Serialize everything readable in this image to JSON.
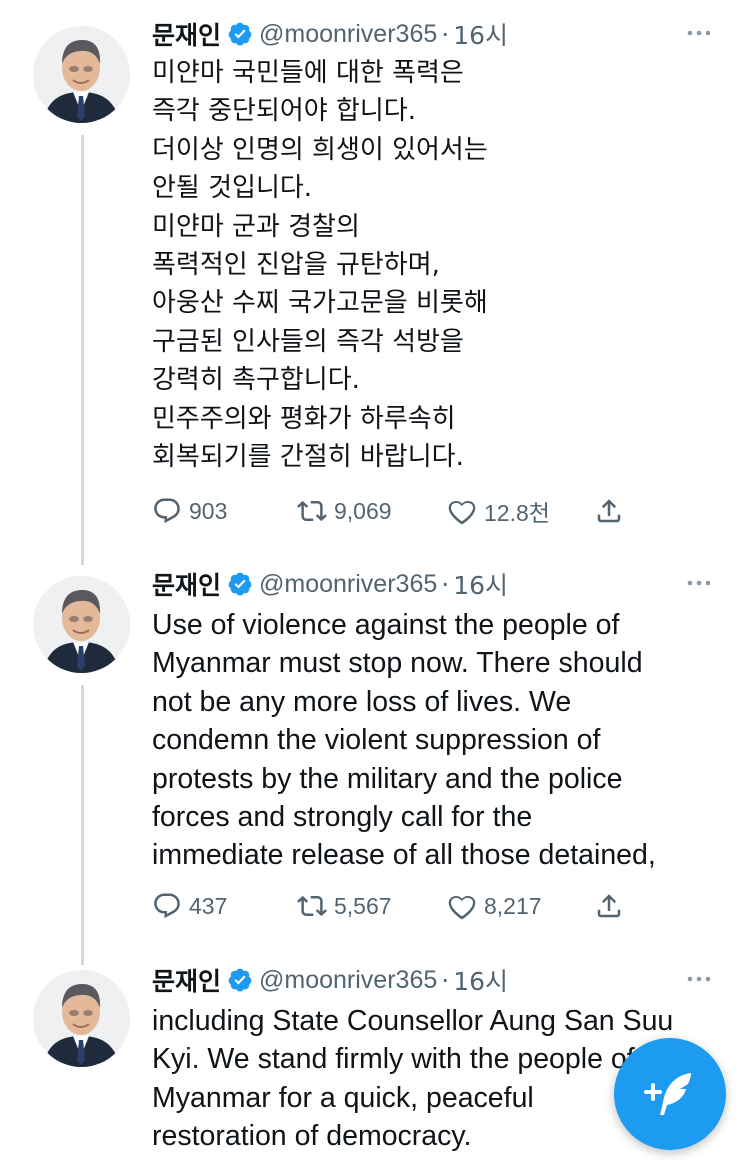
{
  "colors": {
    "accent": "#1d9bf0",
    "muted": "#536471",
    "text": "#0f1419"
  },
  "tweets": [
    {
      "name": "문재인",
      "handle": "@moonriver365",
      "dot": "·",
      "time": "16시",
      "lines": [
        "미얀마 국민들에 대한 폭력은",
        "즉각 중단되어야 합니다.",
        "더이상 인명의 희생이 있어서는",
        "안될 것입니다.",
        "미얀마 군과 경찰의",
        "폭력적인 진압을 규탄하며,",
        "아웅산 수찌 국가고문을 비롯해",
        "구금된 인사들의 즉각 석방을",
        "강력히 촉구합니다.",
        "민주주의와 평화가 하루속히",
        "회복되기를 간절히 바랍니다."
      ],
      "replies": "903",
      "retweets": "9,069",
      "likes": "12.8천"
    },
    {
      "name": "문재인",
      "handle": "@moonriver365",
      "dot": "·",
      "time": "16시",
      "lines": [
        "Use of violence against the people of",
        "Myanmar must stop now. There should",
        "not be any more loss of lives. We",
        "condemn the violent suppression of",
        "protests by the military and the police",
        "forces and strongly call for the",
        "immediate release of all those detained,"
      ],
      "replies": "437",
      "retweets": "5,567",
      "likes": "8,217"
    },
    {
      "name": "문재인",
      "handle": "@moonriver365",
      "dot": "·",
      "time": "16시",
      "lines": [
        "including State Counsellor Aung San Suu",
        "Kyi. We stand firmly with the people of",
        "Myanmar for a quick, peaceful",
        "restoration of democracy."
      ]
    }
  ],
  "icons": {
    "verified": "verified-badge-icon",
    "more": "more-options-icon",
    "reply": "reply-icon",
    "retweet": "retweet-icon",
    "like": "heart-icon",
    "share": "share-icon",
    "compose": "compose-tweet-icon"
  }
}
